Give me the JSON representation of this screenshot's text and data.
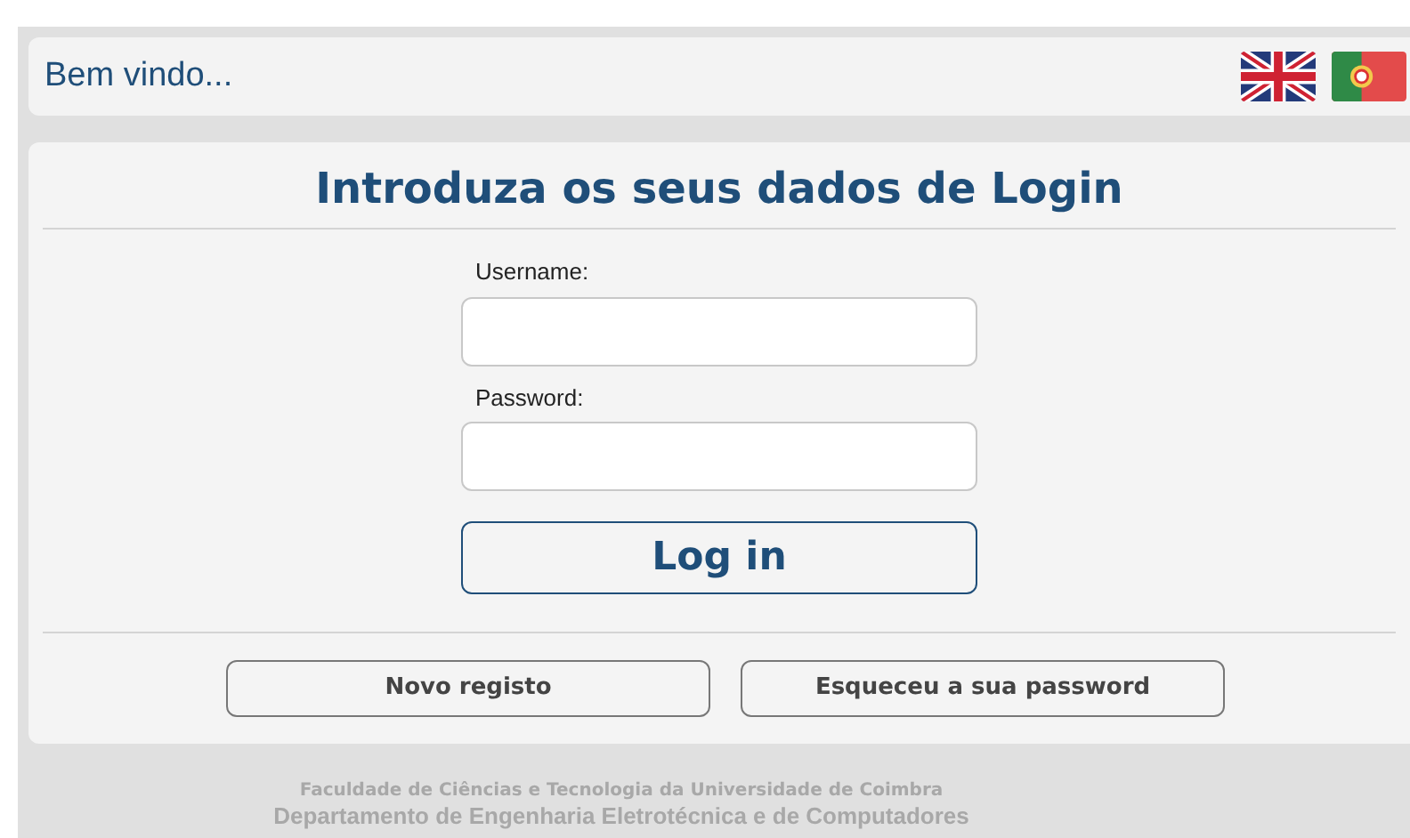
{
  "header": {
    "greeting": "Bem vindo...",
    "languages": [
      {
        "kind": "uk"
      },
      {
        "kind": "pt"
      }
    ]
  },
  "login": {
    "title": "Introduza os seus dados de Login",
    "fields": [
      {
        "label": "Username:"
      },
      {
        "label": "Password:"
      }
    ],
    "submit": "Log in",
    "links": [
      "Novo registo",
      "Esqueceu a sua password"
    ]
  },
  "footer": {
    "line_1": "Faculdade de Ciências e Tecnologia da Universidade de Coimbra",
    "line_2": "Departamento de Engenharia Eletrotécnica e de Computadores"
  }
}
